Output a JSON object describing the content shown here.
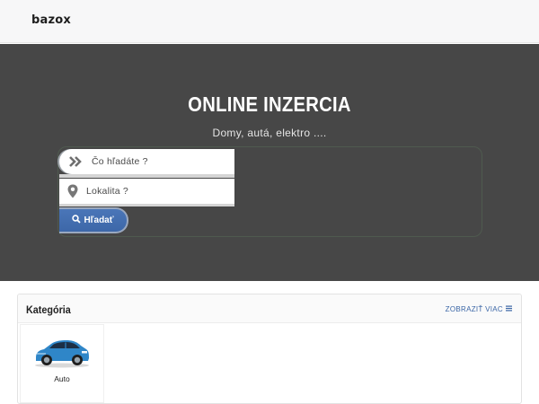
{
  "header": {
    "logo": "bazox"
  },
  "hero": {
    "title": "ONLINE INZERCIA",
    "subtitle": "Domy, autá, elektro ...."
  },
  "search": {
    "what_placeholder": "Čo hľadáte ?",
    "where_placeholder": "Lokalita ?",
    "button_label": "Hľadať",
    "what_icon": "double-chevron-right-icon",
    "where_icon": "map-pin-icon",
    "button_icon": "search-icon"
  },
  "categories": {
    "title": "Kategória",
    "more_label": "ZOBRAZIŤ VIAC",
    "more_icon": "menu-icon",
    "items": [
      {
        "label": "Auto",
        "icon": "car-image"
      }
    ]
  },
  "colors": {
    "hero_bg": "#474747",
    "accent": "#3d67a8",
    "car_blue": "#2f86c8"
  }
}
